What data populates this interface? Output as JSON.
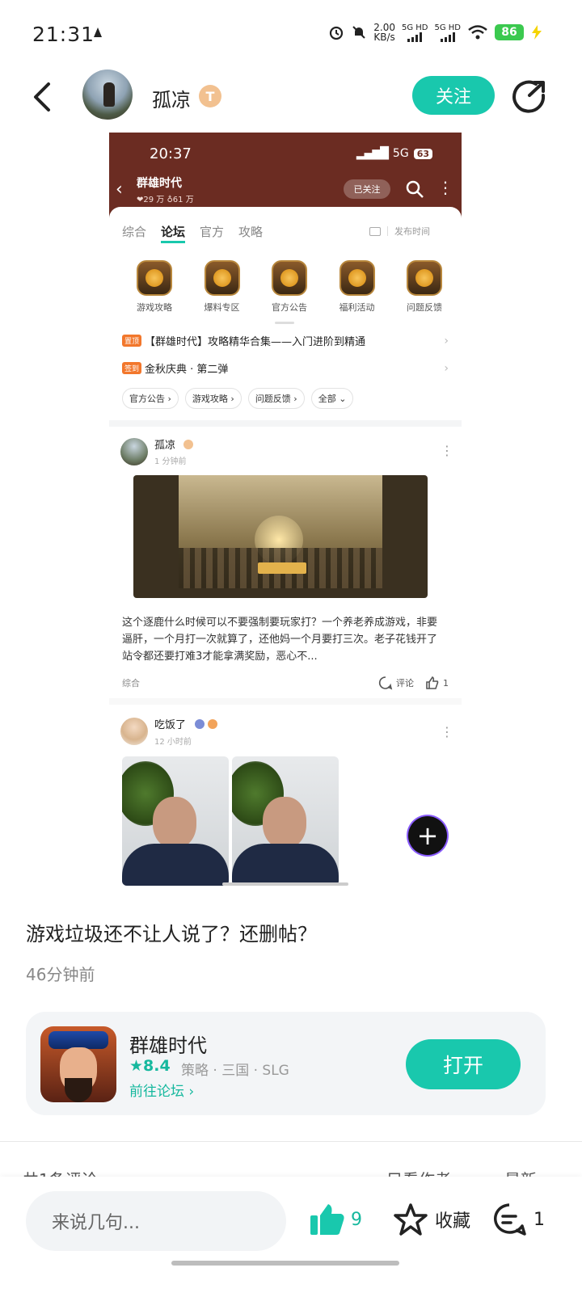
{
  "status_bar": {
    "time": "21:31",
    "net_speed": "2.00",
    "net_unit": "KB/s",
    "sim1": "5G HD",
    "sim2": "5G HD",
    "battery": "86"
  },
  "header": {
    "username": "孤凉",
    "level_badge": "T",
    "follow_label": "关注"
  },
  "embedded_screenshot": {
    "time": "20:37",
    "network": "5G",
    "battery": "63",
    "forum_title": "群雄时代",
    "stats": "❤29 万  ♁61 万",
    "followed_label": "已关注",
    "tabs": [
      "综合",
      "论坛",
      "官方",
      "攻略"
    ],
    "active_tab": "论坛",
    "sort_label": "发布时间",
    "categories": [
      "游戏攻略",
      "爆料专区",
      "官方公告",
      "福利活动",
      "问题反馈"
    ],
    "pinned": [
      {
        "tag": "置顶",
        "text": "【群雄时代】攻略精华合集——入门进阶到精通"
      },
      {
        "tag": "签到",
        "text": "金秋庆典 · 第二弹"
      }
    ],
    "chips": [
      "官方公告 ›",
      "游戏攻略 ›",
      "问题反馈 ›",
      "全部 ⌄"
    ],
    "post1": {
      "author": "孤凉",
      "time": "1 分钟前",
      "text": "这个逐鹿什么时候可以不要强制要玩家打？一个养老养成游戏，非要逼肝，一个月打一次就算了，还他妈一个月要打三次。老子花钱开了站令都还要打难3才能拿满奖励，恶心不...",
      "section": "综合",
      "comment_label": "评论",
      "likes": "1"
    },
    "post2": {
      "author": "吃饭了",
      "time": "12 小时前"
    }
  },
  "post": {
    "title": "游戏垃圾还不让人说了？还删帖？",
    "time": "46分钟前"
  },
  "game_card": {
    "name": "群雄时代",
    "rating": "★8.4",
    "tags": "策略 · 三国 · SLG",
    "forum_link": "前往论坛 ›",
    "open_label": "打开"
  },
  "comments_header": {
    "count_label": "共1条评论",
    "author_only": "只看作者",
    "sort": "最新"
  },
  "bottom_bar": {
    "input_placeholder": "来说几句...",
    "likes": "9",
    "fav_label": "收藏",
    "comments": "1"
  },
  "colors": {
    "accent": "#19c8ad",
    "forum_header": "#6b2c22"
  }
}
